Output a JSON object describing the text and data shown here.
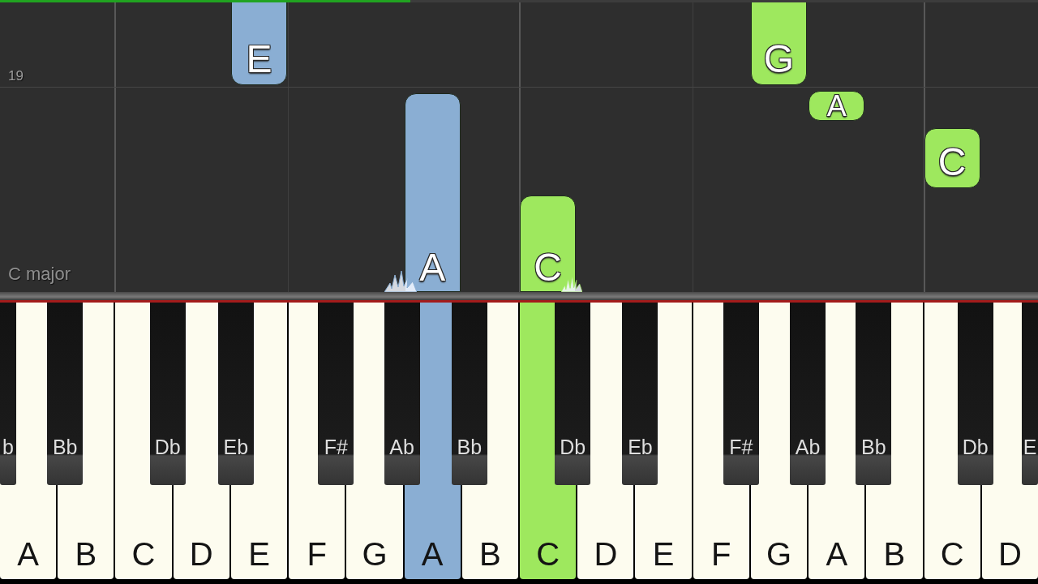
{
  "progress_bar": {
    "level": 0.395
  },
  "roll": {
    "measure_number": "19",
    "key_signature": "C major",
    "notes": [
      {
        "label": "E",
        "color": "#8aaed3",
        "playing": false
      },
      {
        "label": "G",
        "color": "#9ee85e",
        "playing": false
      },
      {
        "label": "A",
        "color": "#9ee85e",
        "playing": false
      },
      {
        "label": "A",
        "color": "#8aaed3",
        "playing": true
      },
      {
        "label": "C",
        "color": "#9ee85e",
        "playing": false
      },
      {
        "label": "C",
        "color": "#9ee85e",
        "playing": true
      }
    ]
  },
  "keyboard": {
    "white_keys": [
      {
        "label": "A",
        "pressed": false
      },
      {
        "label": "B",
        "pressed": false
      },
      {
        "label": "C",
        "pressed": false
      },
      {
        "label": "D",
        "pressed": false
      },
      {
        "label": "E",
        "pressed": false
      },
      {
        "label": "F",
        "pressed": false
      },
      {
        "label": "G",
        "pressed": false
      },
      {
        "label": "A",
        "pressed": true,
        "color": "#8aaed3"
      },
      {
        "label": "B",
        "pressed": false
      },
      {
        "label": "C",
        "pressed": true,
        "color": "#9ee85e"
      },
      {
        "label": "D",
        "pressed": false
      },
      {
        "label": "E",
        "pressed": false
      },
      {
        "label": "F",
        "pressed": false
      },
      {
        "label": "G",
        "pressed": false
      },
      {
        "label": "A",
        "pressed": false
      },
      {
        "label": "B",
        "pressed": false
      },
      {
        "label": "C",
        "pressed": false
      },
      {
        "label": "D",
        "pressed": false
      }
    ],
    "black_keys": [
      {
        "label": "b"
      },
      {
        "label": "Bb"
      },
      {
        "label": "Db"
      },
      {
        "label": "Eb"
      },
      {
        "label": "F#"
      },
      {
        "label": "Ab"
      },
      {
        "label": "Bb"
      },
      {
        "label": "Db"
      },
      {
        "label": "Eb"
      },
      {
        "label": "F#"
      },
      {
        "label": "Ab"
      },
      {
        "label": "Bb"
      },
      {
        "label": "Db"
      },
      {
        "label": "E"
      }
    ]
  }
}
